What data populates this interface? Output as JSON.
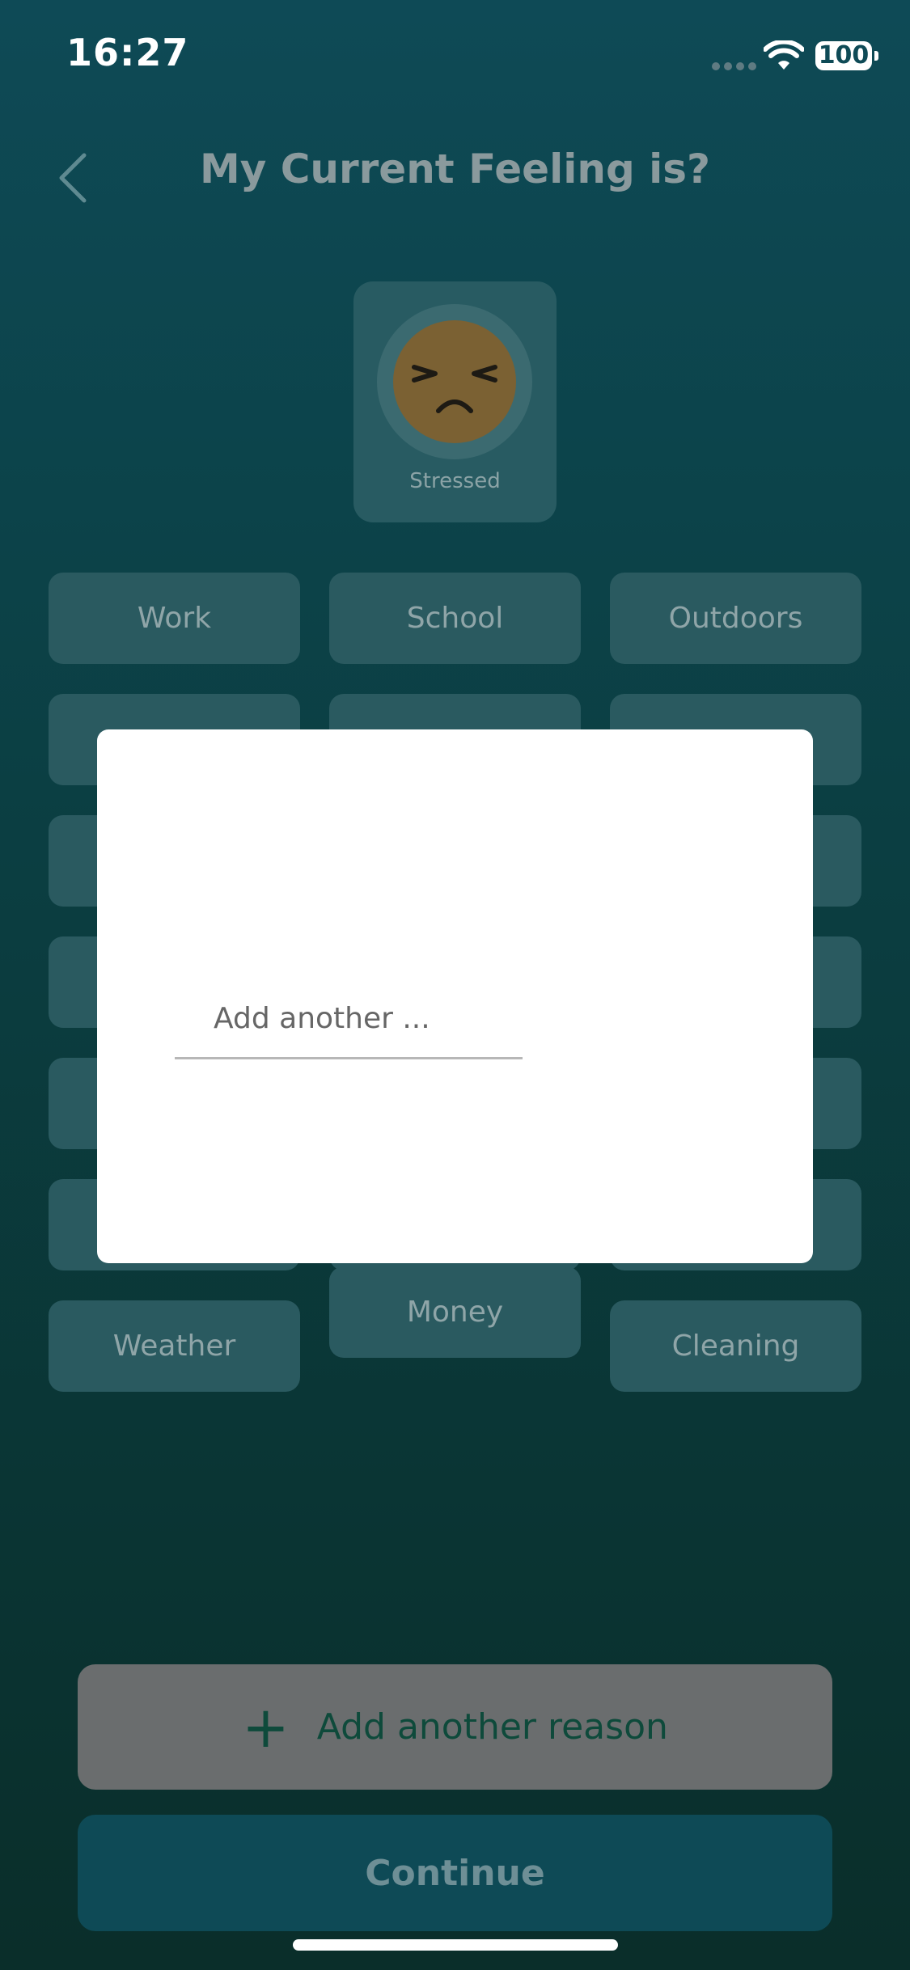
{
  "status": {
    "time": "16:27",
    "battery": "100"
  },
  "header": {
    "title": "My Current Feeling is?"
  },
  "feeling": {
    "label": "Stressed"
  },
  "chips": [
    "Work",
    "School",
    "Outdoors",
    "",
    "",
    "",
    "",
    "",
    "",
    "",
    "",
    "",
    "",
    "",
    "",
    "",
    "",
    "",
    "Weather",
    "Money",
    "Cleaning"
  ],
  "dialog": {
    "input_placeholder": "Add another ..."
  },
  "buttons": {
    "add_reason": "Add another reason",
    "continue": "Continue"
  },
  "colors": {
    "bg_top": "#0e4a56",
    "bg_bottom": "#0a2e2a",
    "chip": "#2a5a60",
    "continue": "#0e4a56"
  }
}
